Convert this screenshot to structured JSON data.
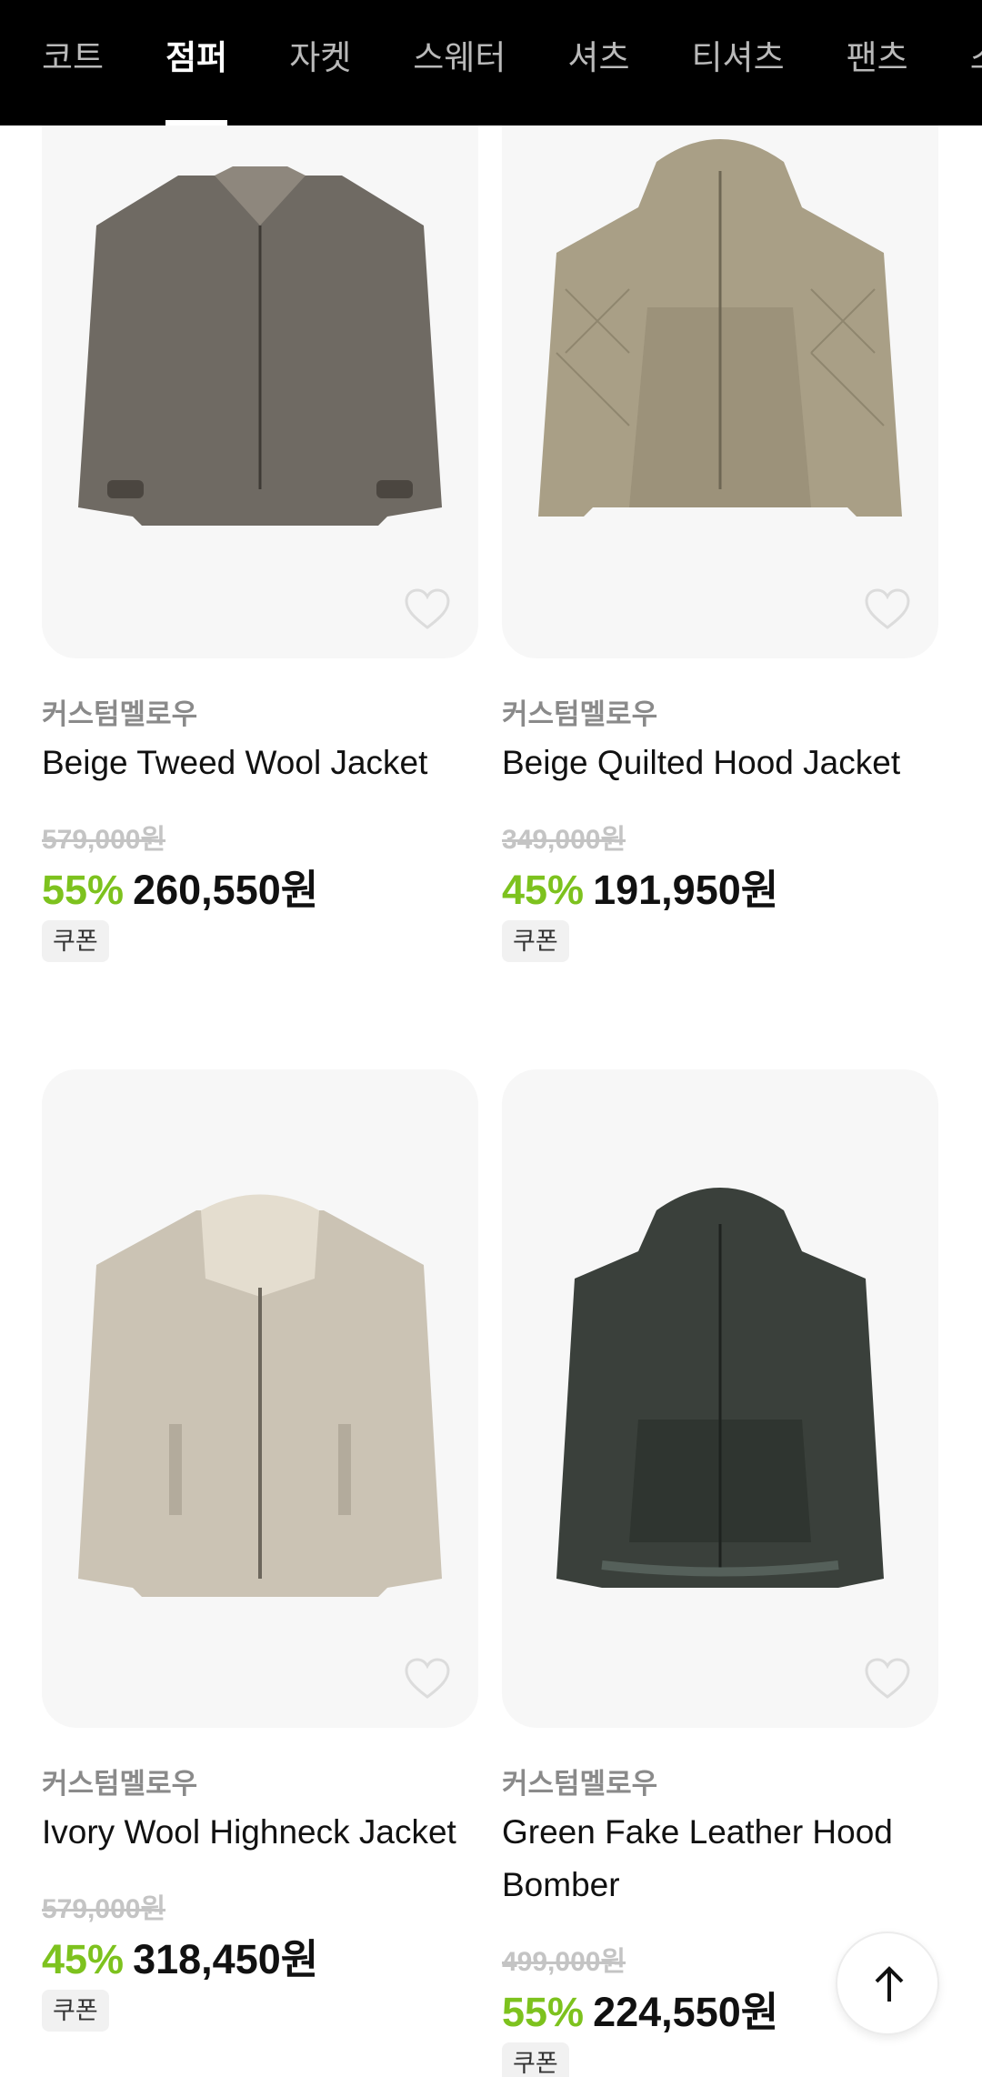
{
  "tabs": [
    "코트",
    "점퍼",
    "자켓",
    "스웨터",
    "셔츠",
    "티셔츠",
    "팬츠",
    "스"
  ],
  "active_tab_index": 1,
  "products": [
    {
      "brand": "커스텀멜로우",
      "name": "Beige Tweed Wool Jacket",
      "original_price": "579,000원",
      "discount": "55%",
      "price": "260,550원",
      "coupon": "쿠폰",
      "image_colors": {
        "body": "#6f6a63",
        "accent": "#8e877d"
      }
    },
    {
      "brand": "커스텀멜로우",
      "name": "Beige Quilted Hood Jacket",
      "original_price": "349,000원",
      "discount": "45%",
      "price": "191,950원",
      "coupon": "쿠폰",
      "image_colors": {
        "body": "#a99f86",
        "accent": "#8f866e"
      }
    },
    {
      "brand": "커스텀멜로우",
      "name": "Ivory Wool Highneck Jacket",
      "original_price": "579,000원",
      "discount": "45%",
      "price": "318,450원",
      "coupon": "쿠폰",
      "image_colors": {
        "body": "#cbc3b4",
        "accent": "#e4ddcf"
      }
    },
    {
      "brand": "커스텀멜로우",
      "name": "Green Fake Leather Hood Bomber",
      "original_price": "499,000원",
      "discount": "55%",
      "price": "224,550원",
      "coupon": "쿠폰",
      "image_colors": {
        "body": "#3a403b",
        "accent": "#55605a"
      }
    }
  ],
  "icons": {
    "wishlist": "heart-outline-icon",
    "scroll_top": "arrow-up-icon"
  },
  "colors": {
    "discount": "#7dc21e",
    "topbar": "#000000"
  }
}
